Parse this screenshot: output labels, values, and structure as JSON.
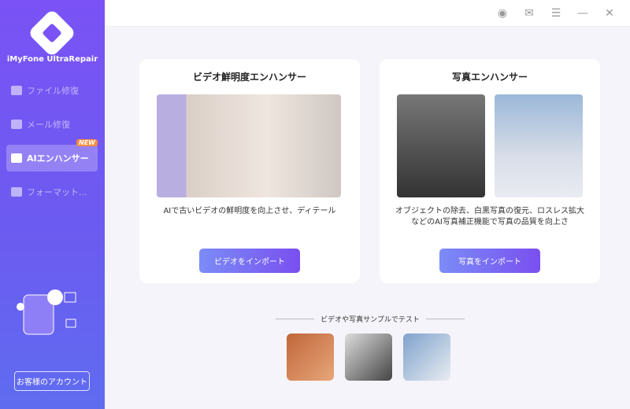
{
  "app": {
    "brand": "iMyFone UltraRepair"
  },
  "sidebar": {
    "items": [
      {
        "label": "ファイル修復"
      },
      {
        "label": "メール修復"
      },
      {
        "label": "AIエンハンサー",
        "badge": "NEW"
      },
      {
        "label": "フォーマット..."
      }
    ],
    "account_label": "お客様のアカウント"
  },
  "titlebar": {
    "icons": [
      "account-icon",
      "mail-icon",
      "menu-icon",
      "minimize-icon",
      "close-icon"
    ]
  },
  "video_card": {
    "title": "ビデオ鮮明度エンハンサー",
    "description": "AIで古いビデオの鮮明度を向上させ、ディテール",
    "button": "ビデオをインポート"
  },
  "photo_card": {
    "title": "写真エンハンサー",
    "description": "オブジェクトの除去、白黒写真の復元、ロスレス拡大などのAI写真補正機能で写真の品質を向上さ",
    "button": "写真をインポート"
  },
  "samples": {
    "label": "ビデオや写真サンプルでテスト"
  },
  "colors": {
    "accent": "#7a52f5",
    "badge": "#ff8a3d"
  }
}
